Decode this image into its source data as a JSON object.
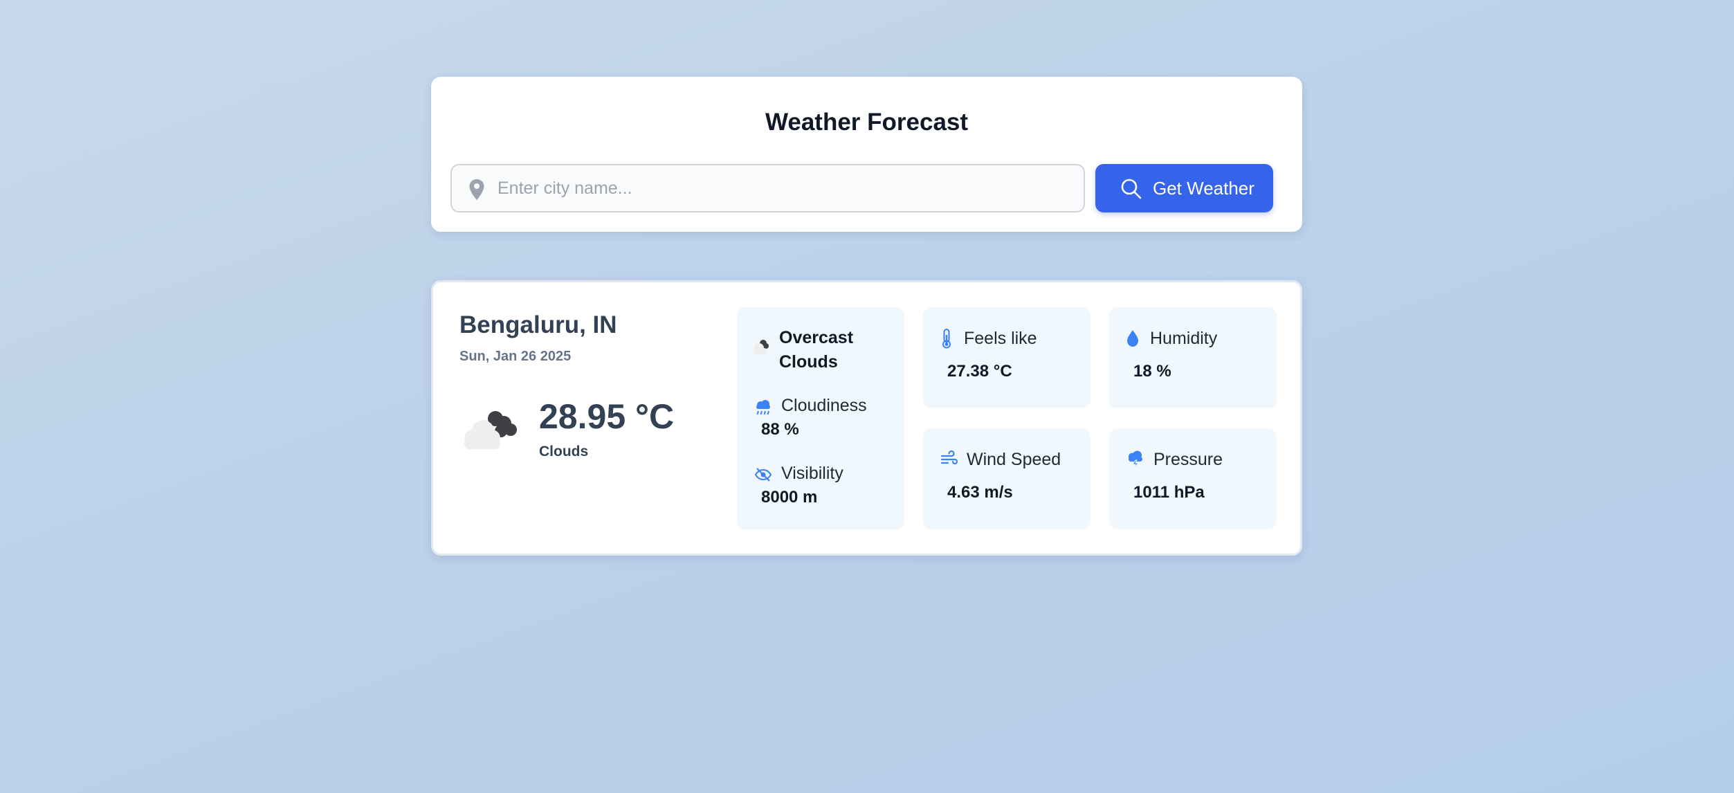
{
  "search": {
    "title": "Weather Forecast",
    "placeholder": "Enter city name...",
    "value": "",
    "button_label": "Get Weather"
  },
  "weather": {
    "city": "Bengaluru, IN",
    "date": "Sun, Jan 26 2025",
    "temperature": "28.95 °C",
    "condition": "Clouds",
    "description": "Overcast Clouds",
    "details": {
      "cloudiness": {
        "label": "Cloudiness",
        "value": "88 %",
        "icon": "cloud-rain-icon"
      },
      "visibility": {
        "label": "Visibility",
        "value": "8000 m",
        "icon": "eye-slash-icon"
      },
      "feels_like": {
        "label": "Feels like",
        "value": "27.38 °C",
        "icon": "thermometer-icon"
      },
      "humidity": {
        "label": "Humidity",
        "value": "18 %",
        "icon": "droplet-icon"
      },
      "wind_speed": {
        "label": "Wind Speed",
        "value": "4.63 m/s",
        "icon": "wind-icon"
      },
      "pressure": {
        "label": "Pressure",
        "value": "1011 hPa",
        "icon": "storm-cloud-icon"
      }
    }
  },
  "colors": {
    "accent": "#3563e9",
    "icon_blue": "#3b82f6",
    "tile_bg": "#f0f7fd",
    "text_dark": "#334155",
    "text_muted": "#64748b"
  }
}
